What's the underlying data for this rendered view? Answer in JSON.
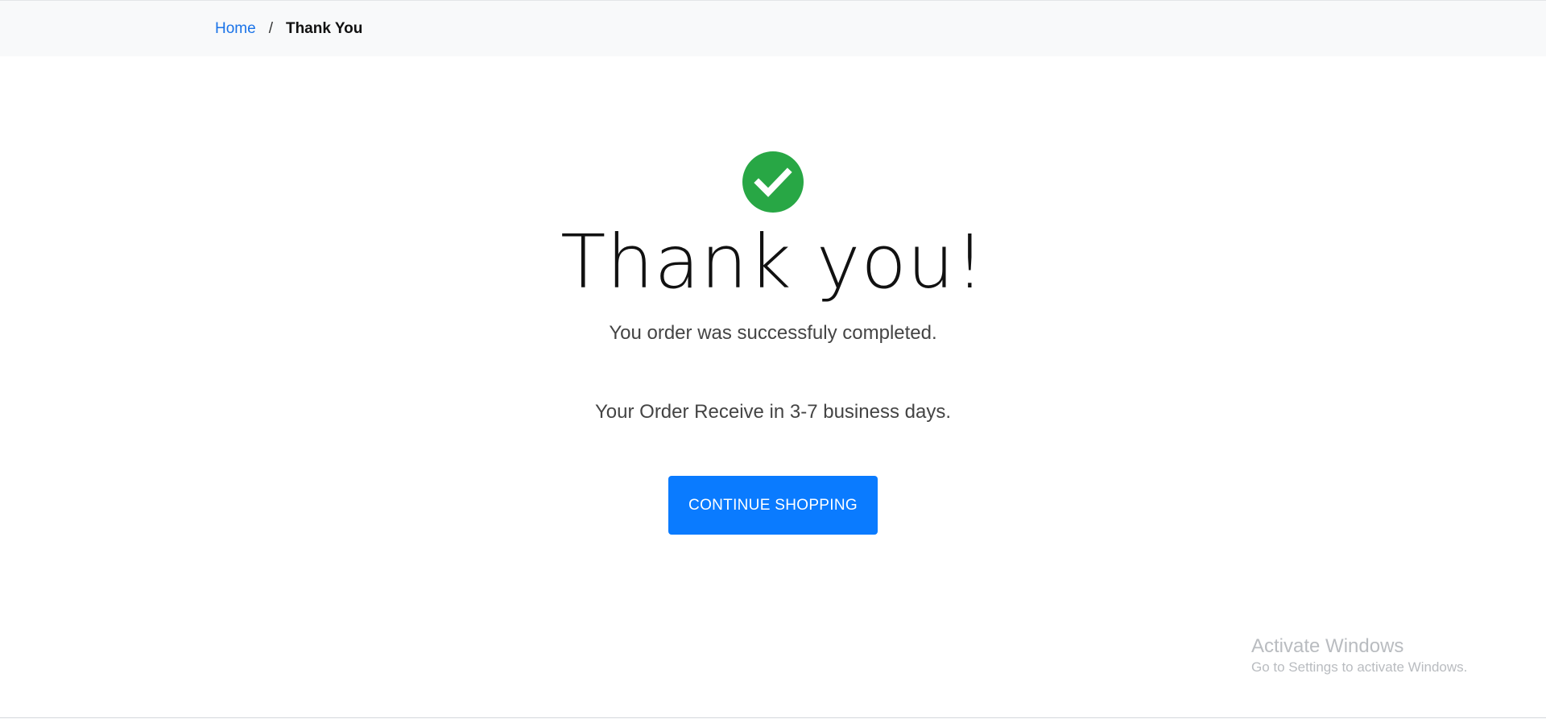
{
  "breadcrumb": {
    "home_label": "Home",
    "separator": "/",
    "current_label": "Thank You"
  },
  "main": {
    "icon": "check-circle-icon",
    "title": "Thank you!",
    "subtitle": "You order was successfuly completed.",
    "delivery_text": "Your Order Receive in 3-7 business days.",
    "continue_button_label": "CONTINUE SHOPPING"
  },
  "watermark": {
    "title": "Activate Windows",
    "subtitle": "Go to Settings to activate Windows."
  },
  "colors": {
    "success": "#28a745",
    "primary_button": "#0a7bff",
    "link": "#1a73e8",
    "breadcrumb_bg": "#f8f9fa"
  }
}
